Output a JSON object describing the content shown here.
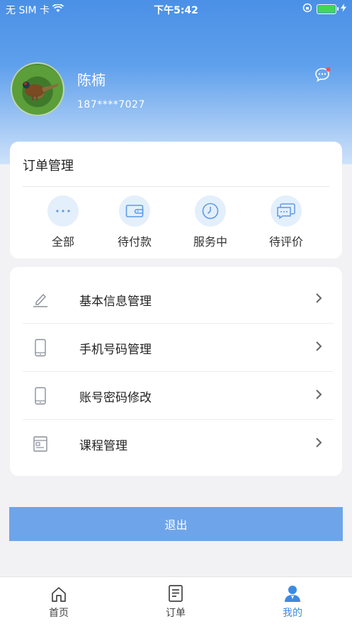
{
  "status_bar": {
    "carrier": "无 SIM 卡",
    "time": "下午5:42"
  },
  "profile": {
    "name": "陈楠",
    "phone": "187****7027"
  },
  "order_card": {
    "title": "订单管理",
    "items": [
      {
        "label": "全部",
        "icon": "more-dots-icon"
      },
      {
        "label": "待付款",
        "icon": "wallet-icon"
      },
      {
        "label": "服务中",
        "icon": "clock-icon"
      },
      {
        "label": "待评价",
        "icon": "chat-review-icon"
      }
    ]
  },
  "menu": {
    "items": [
      {
        "label": "基本信息管理",
        "icon": "pencil-icon"
      },
      {
        "label": "手机号码管理",
        "icon": "phone-icon"
      },
      {
        "label": "账号密码修改",
        "icon": "phone-icon"
      },
      {
        "label": "课程管理",
        "icon": "document-icon"
      }
    ]
  },
  "logout_label": "退出",
  "tabbar": {
    "items": [
      {
        "label": "首页",
        "icon": "home-icon"
      },
      {
        "label": "订单",
        "icon": "order-list-icon"
      },
      {
        "label": "我的",
        "icon": "user-icon",
        "active": true
      }
    ]
  },
  "colors": {
    "accent": "#3d8ae2",
    "header": "#4a90e6",
    "logout": "#6ea5ea",
    "icon_bg": "#e4effc"
  }
}
